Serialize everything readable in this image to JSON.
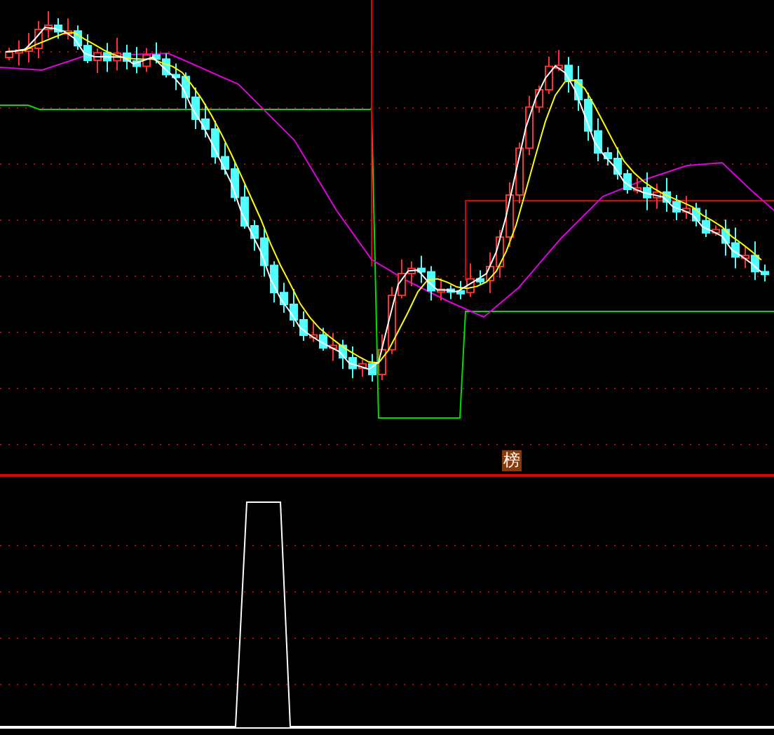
{
  "signal_badge": {
    "label": "榜"
  }
}
